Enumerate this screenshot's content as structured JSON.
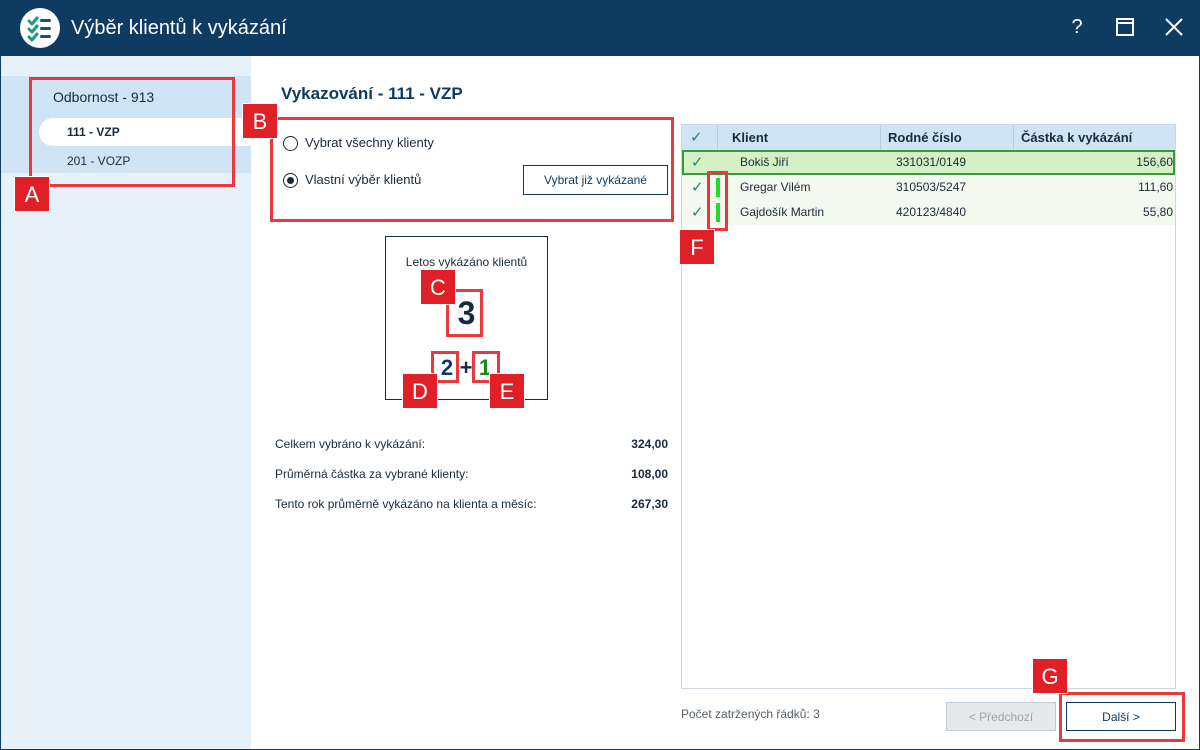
{
  "window": {
    "title": "Výběr klientů k vykázání",
    "help_glyph": "?",
    "maximize_glyph": "☐",
    "close_glyph": "✕",
    "accent": "#0d3b62"
  },
  "sidebar": {
    "title": "Odbornost - 913",
    "items": [
      {
        "label": "111 - VZP",
        "active": true
      },
      {
        "label": "201 - VOZP",
        "active": false
      }
    ]
  },
  "main": {
    "heading": "Vykazování - 111 - VZP",
    "radio_all_label": "Vybrat všechny klienty",
    "radio_all_selected": false,
    "radio_custom_label": "Vlastní výběr klientů",
    "radio_custom_selected": true,
    "select_reported_button": "Vybrat již vykázané"
  },
  "stats": {
    "label": "Letos vykázáno klientů",
    "total": "3",
    "part_a": "2",
    "plus": "+",
    "part_b": "1"
  },
  "summary": [
    {
      "label": "Celkem vybráno k vykázání:",
      "value": "324,00"
    },
    {
      "label": "Průměrná částka za vybrané klienty:",
      "value": "108,00"
    },
    {
      "label": "Tento rok průměrně vykázáno na klienta a měsíc:",
      "value": "267,30"
    }
  ],
  "grid": {
    "check_header": "✓",
    "columns": [
      "Klient",
      "Rodné číslo",
      "Částka k vykázání"
    ],
    "rows": [
      {
        "name": "Bokiš Jiří",
        "rc": "331031/0149",
        "amount": "156,60",
        "checked": true,
        "marker": false,
        "selected": true
      },
      {
        "name": "Gregar Vilém",
        "rc": "310503/5247",
        "amount": "111,60",
        "checked": true,
        "marker": true,
        "selected": false
      },
      {
        "name": "Gajdošík Martin",
        "rc": "420123/4840",
        "amount": "55,80",
        "checked": true,
        "marker": true,
        "selected": false
      }
    ],
    "check_glyph": "✓",
    "marker_color": "#22dd22"
  },
  "footer": {
    "checked_count": "Počet zatržených řádků: 3",
    "prev_button": "< Předchozí",
    "next_button": "Další >"
  },
  "annotations": {
    "A": "A",
    "B": "B",
    "C": "C",
    "D": "D",
    "E": "E",
    "F": "F",
    "G": "G",
    "color": "#e8393e"
  }
}
